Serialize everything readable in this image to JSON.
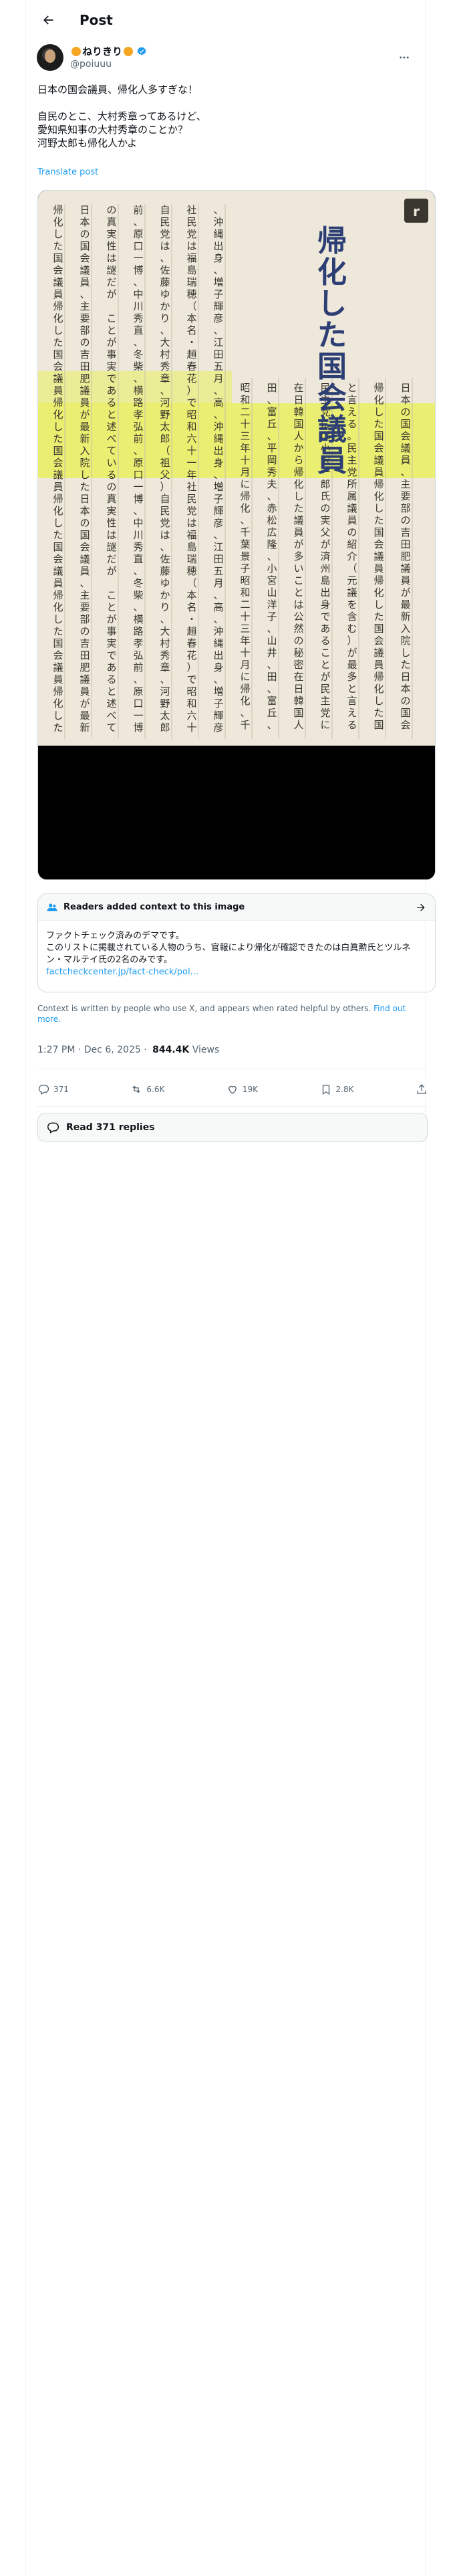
{
  "header": {
    "title": "Post",
    "back_icon": "back-arrow-icon"
  },
  "author": {
    "display_name": "ねりきり",
    "handle": "@poiuuu",
    "verified": true
  },
  "tweet": {
    "lines": [
      "日本の国会議員、帰化人多すぎな！",
      "自民のとこ、大村秀章ってあるけど、",
      "愛知県知事の大村秀章のことか？",
      "河野太郎も帰化人かよ"
    ],
    "translate_label": "Translate post"
  },
  "media": {
    "headline": "帰化した国会議員",
    "badge": "r",
    "columns": [
      "日本の国会議員、主要部の吉田肥議員が最新入院した",
      "帰化した国会議員",
      "と言える。民主党所属議員の紹介（元議を含む）が最多",
      "民主党には小沢一郎氏の実父が済州島出身であることが",
      "在日韓国人から帰化した議員が多いことは公然の秘密",
      "田、富丘、平岡秀夫、赤松広隆、小宮山洋子、山井、",
      "昭和二十三年十月に帰化、千葉景子",
      "、沖縄出身、増子輝彦、江田五月、高",
      "社民党は福島瑞穂（本名・趙春花）で昭和六十一年",
      "自民党は、佐藤ゆかり、大村秀章、河野太郎（祖父）",
      "前、原口一博、中川秀直、冬柴、横路孝弘",
      "の真実性は謎だが ことが事実であると述べている"
    ]
  },
  "context": {
    "title": "Readers added context to this image",
    "body_line_1": "ファクトチェック済みのデマです。",
    "body_line_2": "このリストに掲載されている人物のうち、官報により帰化が確認できたのは白眞勲氏とツルネン・マルテイ氏の2名のみです。",
    "link": "factcheckcenter.jp/fact-check/pol...",
    "footer_text": "Context is written by people who use X, and appears when rated helpful by others.",
    "footer_link": "Find out more."
  },
  "meta": {
    "time": "1:27 PM",
    "date": "Dec 6, 2025",
    "views": "844.4K",
    "views_label": "Views"
  },
  "actions": {
    "replies": "371",
    "reposts": "6.6K",
    "likes": "19K",
    "bookmarks": "2.8K"
  },
  "replies_button": {
    "label": "Read 371 replies"
  },
  "colors": {
    "accent": "#1d9bf0",
    "text": "#0f1419",
    "muted": "#536471",
    "highlight": "#e7ee5a"
  }
}
